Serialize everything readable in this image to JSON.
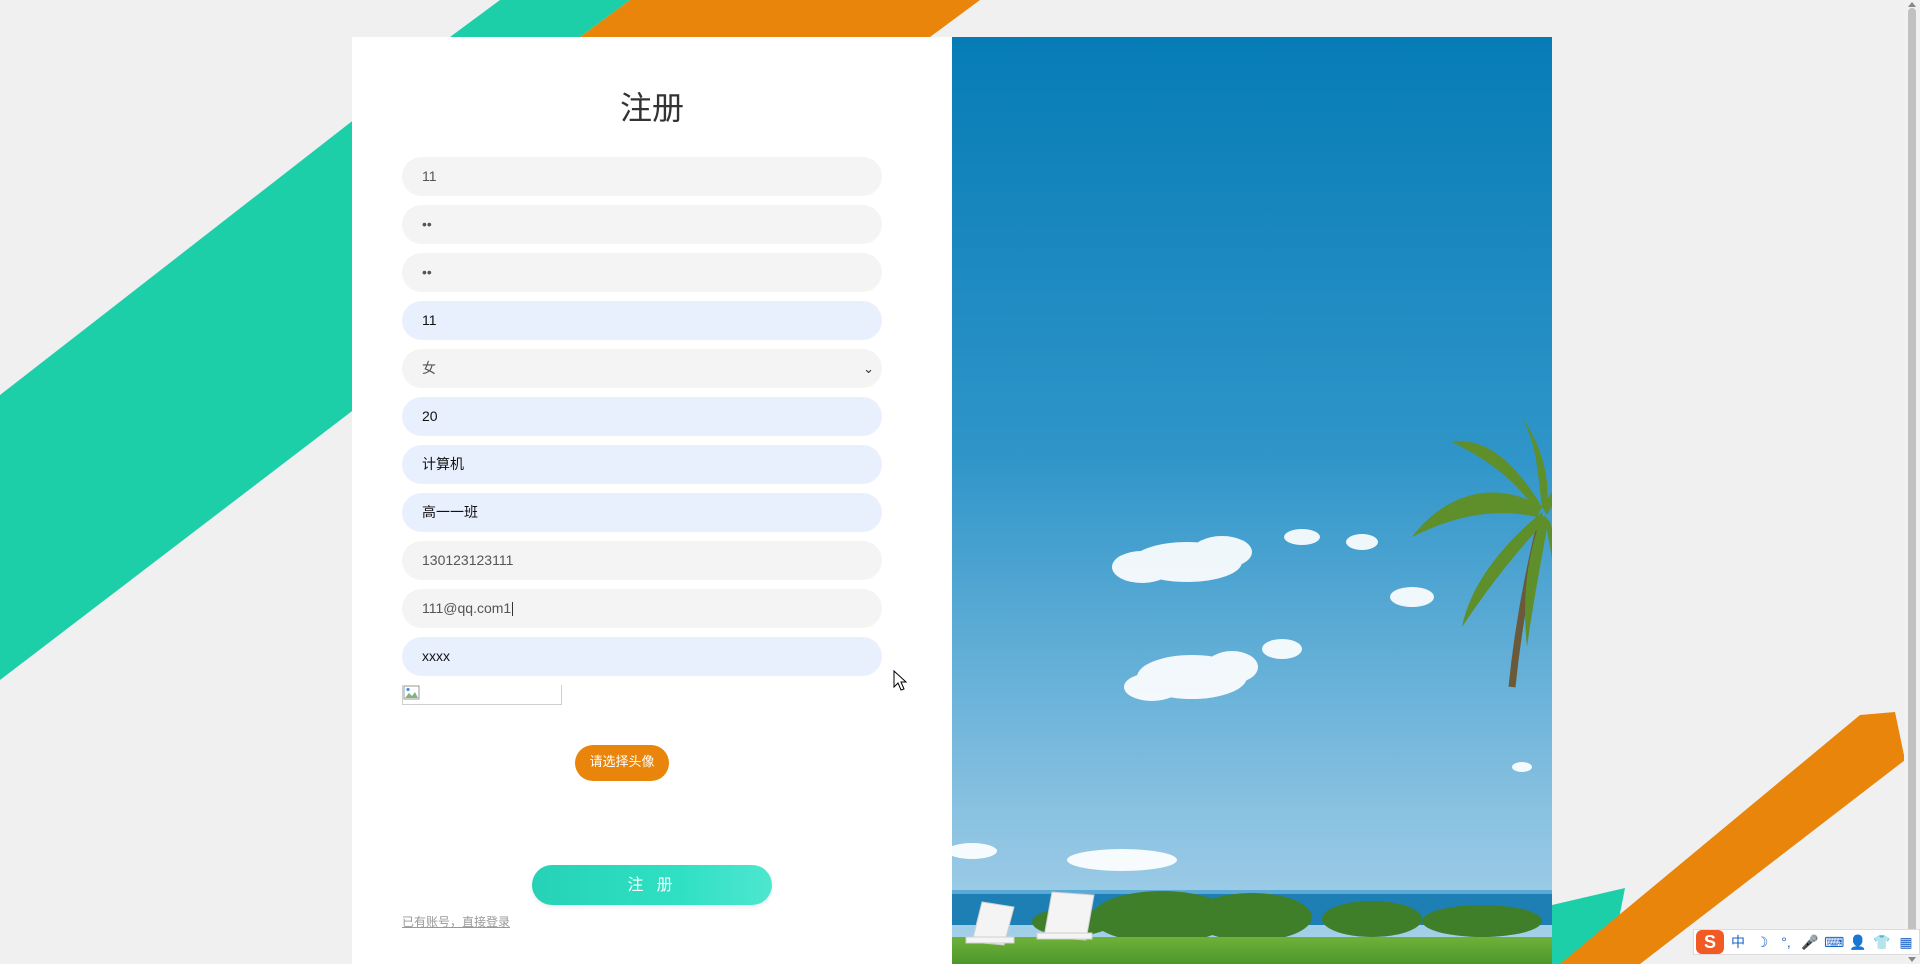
{
  "form": {
    "title": "注册",
    "fields": [
      {
        "name": "username",
        "value": "11"
      },
      {
        "name": "password",
        "value": "••"
      },
      {
        "name": "confirm-password",
        "value": "••"
      },
      {
        "name": "realname",
        "value": "11"
      },
      {
        "name": "gender",
        "value": "女"
      },
      {
        "name": "age",
        "value": "20"
      },
      {
        "name": "major",
        "value": "计算机"
      },
      {
        "name": "class",
        "value": "高一一班"
      },
      {
        "name": "phone",
        "value": "130123123111"
      },
      {
        "name": "email",
        "value": "111@qq.com1"
      },
      {
        "name": "address",
        "value": "xxxx"
      }
    ],
    "choose_avatar_label": "请选择头像",
    "submit_label": "注 册",
    "login_link": "已有账号，直接登录"
  },
  "ime": {
    "logo": "S",
    "items": [
      "中",
      "☽",
      "°,",
      "🎤",
      "⌨",
      "👤",
      "👕",
      "▦"
    ]
  },
  "colors": {
    "teal": "#1ccfa8",
    "orange": "#e8850a",
    "sky": "#0a7fb9",
    "autofill": "#e8f0fe"
  }
}
